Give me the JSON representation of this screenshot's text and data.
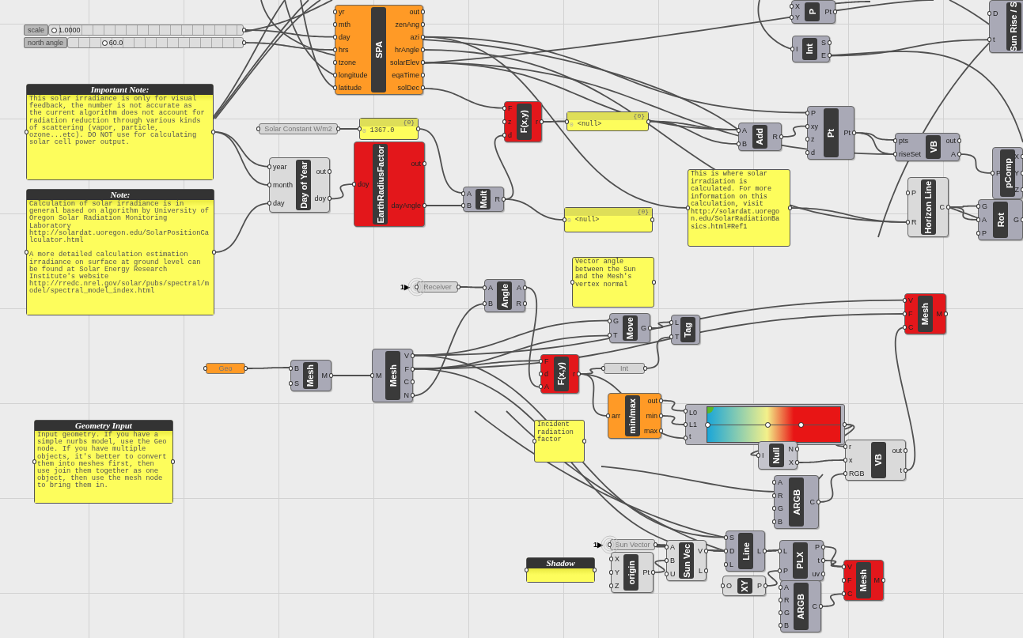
{
  "nodes": [
    {
      "kind": "slider",
      "label": "scale",
      "value": "1.0000",
      "level": 0.0
    },
    {
      "kind": "slider",
      "label": "north angle",
      "value": "60.0",
      "level": 0.18
    },
    {
      "kind": "component",
      "name": "SPA",
      "color": "#ff9a26",
      "inputs": [
        "yr",
        "mth",
        "day",
        "hrs",
        "tzone",
        "longitude",
        "latitude"
      ],
      "outputs": [
        "out",
        "zenAng",
        "azi",
        "hrAngle",
        "solarElev",
        "eqaTime",
        "solDec"
      ]
    },
    {
      "kind": "note",
      "title": "Important Note:",
      "text": "This solar irradiance is only for visual\nfeedback, the number is not accurate as\nthe current algorithm does not account for\nradiation reduction through various kinds\nof scattering (vapor, particle,\nozone...etc). DO NOT use for calculating\nsolar cell power output."
    },
    {
      "kind": "note",
      "title": "Note:",
      "text": "Calculation of solar irradiance is in\ngeneral based on algorithm by University of\nOregon Solar Radiation Monitoring\nLaboratory\nhttp://solardat.uoregon.edu/SolarPositionCa\nlculator.html\n\nA more detailed calculation estimation\nirradiance on surface at ground level can\nbe found at Solar Energy Research\nInstitute's website\nhttp://rredc.nrel.gov/solar/pubs/spectral/m\nodel/spectral_model_index.html"
    },
    {
      "kind": "param",
      "label": "Solar Constant W/m2",
      "color": "#d6d6d6"
    },
    {
      "kind": "panel",
      "header": "{0}",
      "index": "0",
      "text": "1367.0"
    },
    {
      "kind": "component",
      "name": "Day of Year",
      "color": "#dadada",
      "inputs": [
        "year",
        "month",
        "day"
      ],
      "outputs": [
        "out",
        "doy"
      ]
    },
    {
      "kind": "component",
      "name": "EarthRadiusFactor",
      "color": "#e3171b",
      "inputs": [
        "doy"
      ],
      "outputs": [
        "out",
        "dayAngle"
      ]
    },
    {
      "kind": "component",
      "name": "F(x,y)",
      "color": "#e3171b",
      "inputs": [
        "F",
        "z",
        "d"
      ],
      "outputs": [
        "r"
      ]
    },
    {
      "kind": "panel",
      "header": "{0}",
      "index": "0",
      "text": "<null>"
    },
    {
      "kind": "component",
      "name": "Mult",
      "color": "#a9a9b6",
      "inputs": [
        "A",
        "B"
      ],
      "outputs": [
        "R"
      ]
    },
    {
      "kind": "panel",
      "header": "{0}",
      "index": "0",
      "text": "<null>"
    },
    {
      "kind": "component",
      "name": "Add",
      "color": "#a9a9b6",
      "inputs": [
        "A",
        "B"
      ],
      "outputs": [
        "R"
      ]
    },
    {
      "kind": "component",
      "name": "Pt",
      "color": "#a9a9b6",
      "inputs": [
        "P",
        "xy",
        "z",
        "d"
      ],
      "outputs": [
        "Pt"
      ]
    },
    {
      "kind": "component",
      "name": "VB",
      "color": "#a9a9b6",
      "inputs": [
        "pts",
        "riseSet"
      ],
      "outputs": [
        "out",
        "A"
      ]
    },
    {
      "kind": "component",
      "name": "pComp",
      "color": "#a9a9b6",
      "inputs": [
        "P"
      ],
      "outputs": [
        "X",
        "Y",
        "Z"
      ]
    },
    {
      "kind": "panel",
      "text": "This is where solar\nirradiation is\ncalculated. For more\ninformation on this\ncalculation, visit\nhttp://solardat.uorego\nn.edu/SolarRadiationBa\nsics.html#Ref1"
    },
    {
      "kind": "component",
      "name": "Horizon Line",
      "color": "#dadada",
      "inputs": [
        "P",
        "R"
      ],
      "outputs": [
        "C"
      ]
    },
    {
      "kind": "component",
      "name": "Rot",
      "color": "#a9a9b6",
      "inputs": [
        "G",
        "A",
        "P"
      ],
      "outputs": [
        "G"
      ]
    },
    {
      "kind": "component",
      "name": "P",
      "color": "#a9a9b6",
      "inputs": [
        "X",
        "Y"
      ],
      "outputs": [
        "Pt"
      ]
    },
    {
      "kind": "component",
      "name": "Int",
      "color": "#a9a9b6",
      "inputs": [
        "I"
      ],
      "outputs": [
        "S",
        "E"
      ]
    },
    {
      "kind": "component",
      "name": "Sun Rise / S",
      "color": "#a9a9b6",
      "inputs": [
        "D",
        "t"
      ]
    },
    {
      "kind": "param",
      "label": "Receiver",
      "prefix": "1▶",
      "color": "#d6d6d6"
    },
    {
      "kind": "component",
      "name": "Angle",
      "color": "#a9a9b6",
      "inputs": [
        "A",
        "B"
      ],
      "outputs": [
        "A",
        "R"
      ]
    },
    {
      "kind": "panel",
      "text": "Vector angle\nbetween the Sun\nand the Mesh's\nvertex normal"
    },
    {
      "kind": "param",
      "label": "Geo",
      "color": "#ff9a26"
    },
    {
      "kind": "component",
      "name": "Mesh",
      "color": "#a9a9b6",
      "inputs": [
        "B",
        "S"
      ],
      "outputs": [
        "M"
      ]
    },
    {
      "kind": "component",
      "name": "Mesh",
      "color": "#a9a9b6",
      "inputs": [
        "M"
      ],
      "outputs": [
        "V",
        "F",
        "C",
        "N"
      ]
    },
    {
      "kind": "component",
      "name": "Move",
      "color": "#a9a9b6",
      "inputs": [
        "G",
        "T"
      ],
      "outputs": [
        "G"
      ]
    },
    {
      "kind": "component",
      "name": "Tag",
      "color": "#a9a9b6",
      "inputs": [
        "L",
        "T"
      ]
    },
    {
      "kind": "component",
      "name": "Mesh",
      "color": "#e3171b",
      "inputs": [
        "V",
        "F",
        "C"
      ],
      "outputs": [
        "M"
      ]
    },
    {
      "kind": "component",
      "name": "F(x,y)",
      "color": "#e3171b",
      "inputs": [
        "F",
        "d",
        "A"
      ],
      "outputs": [
        "r"
      ]
    },
    {
      "kind": "param",
      "label": "Int",
      "color": "#d6d6d6"
    },
    {
      "kind": "component",
      "name": "min/max",
      "color": "#ff9a26",
      "inputs": [
        "arr"
      ],
      "outputs": [
        "out",
        "min",
        "max"
      ]
    },
    {
      "kind": "gradient",
      "inputs": [
        "L0",
        "L1",
        "t"
      ]
    },
    {
      "kind": "note",
      "title": "Geometry Input",
      "text": "Input geometry. If you have a\nsimple nurbs model, use the Geo\nnode. If you have multiple\nobjects, it's better to convert\nthem into meshes first, then\nuse join them together as one\nobject, then use the mesh node\nto bring them in."
    },
    {
      "kind": "panel",
      "text": "Incident\nradiation\nfactor"
    },
    {
      "kind": "component",
      "name": "Null",
      "color": "#c4c4cc",
      "inputs": [
        "I"
      ],
      "outputs": [
        "N",
        "X"
      ]
    },
    {
      "kind": "component",
      "name": "VB",
      "color": "#dadada",
      "inputs": [
        "r",
        "x",
        "RGB"
      ],
      "outputs": [
        "out",
        "t"
      ]
    },
    {
      "kind": "component",
      "name": "ARGB",
      "color": "#a9a9b6",
      "inputs": [
        "A",
        "R",
        "G",
        "B"
      ],
      "outputs": [
        "C"
      ]
    },
    {
      "kind": "note",
      "title": "Shadow"
    },
    {
      "kind": "param",
      "label": "Sun Vector",
      "prefix": "1▶",
      "color": "#d6d6d6"
    },
    {
      "kind": "component",
      "name": "origin",
      "color": "#dadada",
      "inputs": [
        "X",
        "Y",
        "Z"
      ],
      "outputs": [
        "Pt"
      ]
    },
    {
      "kind": "component",
      "name": "Sun Vec",
      "color": "#dadada",
      "inputs": [
        "A",
        "B",
        "U"
      ],
      "outputs": [
        "V",
        "L"
      ]
    },
    {
      "kind": "component",
      "name": "Line",
      "color": "#a9a9b6",
      "inputs": [
        "S",
        "D",
        "L"
      ],
      "outputs": [
        "L"
      ]
    },
    {
      "kind": "component",
      "name": "XY",
      "color": "#dadada",
      "inputs": [
        "O"
      ],
      "outputs": [
        "P"
      ]
    },
    {
      "kind": "component",
      "name": "PLX",
      "color": "#a9a9b6",
      "inputs": [
        "L",
        "P"
      ],
      "outputs": [
        "P",
        "t",
        "uv"
      ]
    },
    {
      "kind": "component",
      "name": "Mesh",
      "color": "#e3171b",
      "inputs": [
        "V",
        "F",
        "C"
      ],
      "outputs": [
        "M"
      ]
    },
    {
      "kind": "component",
      "name": "ARGB",
      "color": "#a9a9b6",
      "inputs": [
        "A",
        "R",
        "G",
        "B"
      ],
      "outputs": [
        "C"
      ]
    }
  ]
}
